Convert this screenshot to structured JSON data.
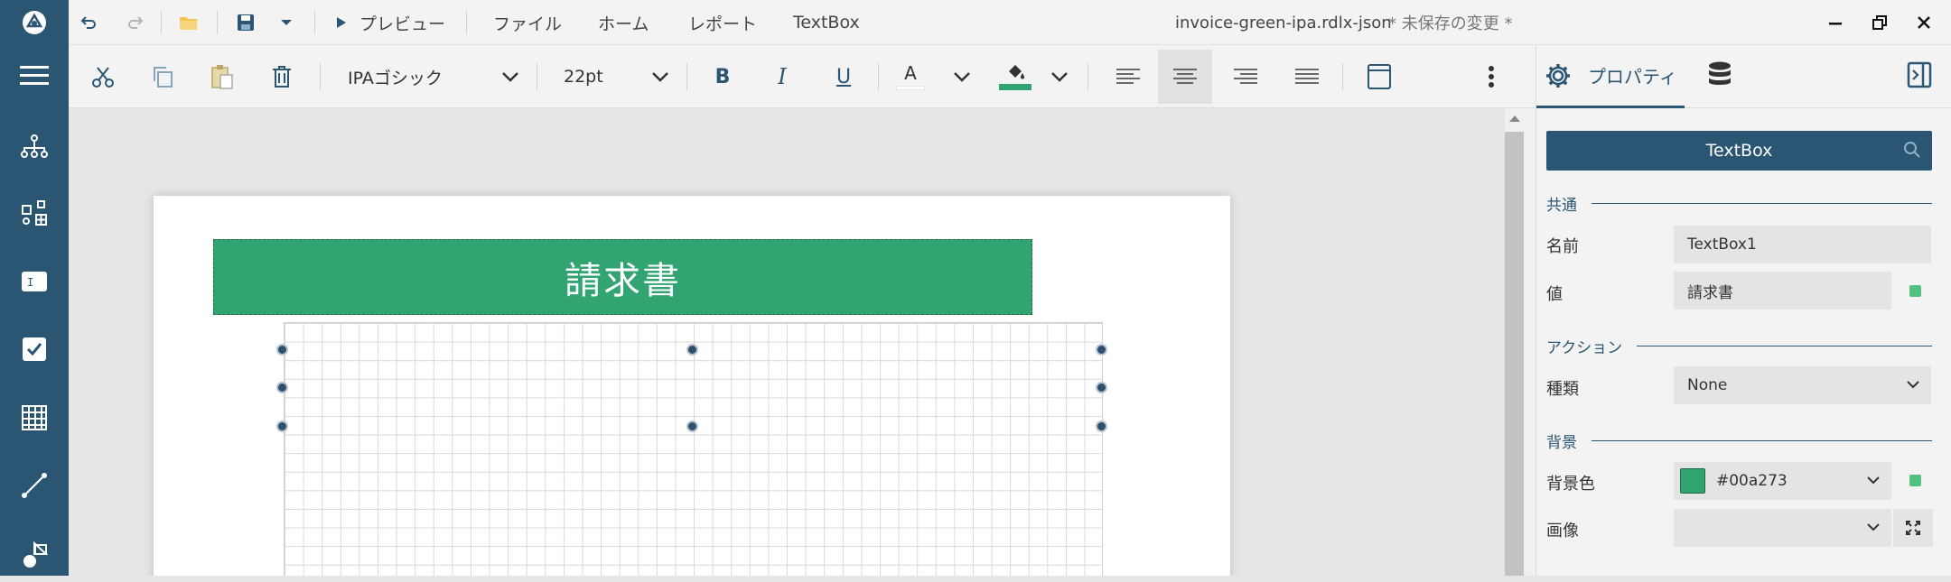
{
  "titlebar": {
    "menu_preview": "プレビュー",
    "menu_file": "ファイル",
    "menu_home": "ホーム",
    "menu_report": "レポート",
    "menu_textbox": "TextBox",
    "file_name": "invoice-green-ipa.rdlx-json",
    "unsaved": "* 未保存の変更 *"
  },
  "toolbar": {
    "font_family": "IPAゴシック",
    "font_size": "22pt",
    "bold": "B",
    "italic": "I",
    "underline": "U",
    "font_color_letter": "A",
    "fill_color": "#31a471"
  },
  "canvas": {
    "textbox_text": "請求書",
    "textbox_bg": "#31a471"
  },
  "properties": {
    "tab_properties": "プロパティ",
    "object_name": "TextBox",
    "section_common": "共通",
    "label_name": "名前",
    "value_name": "TextBox1",
    "label_value": "値",
    "value_value": "請求書",
    "section_action": "アクション",
    "label_type": "種類",
    "value_type": "None",
    "section_background": "背景",
    "label_bgcolor": "背景色",
    "value_bgcolor": "#00a273",
    "label_image": "画像",
    "value_image": ""
  }
}
